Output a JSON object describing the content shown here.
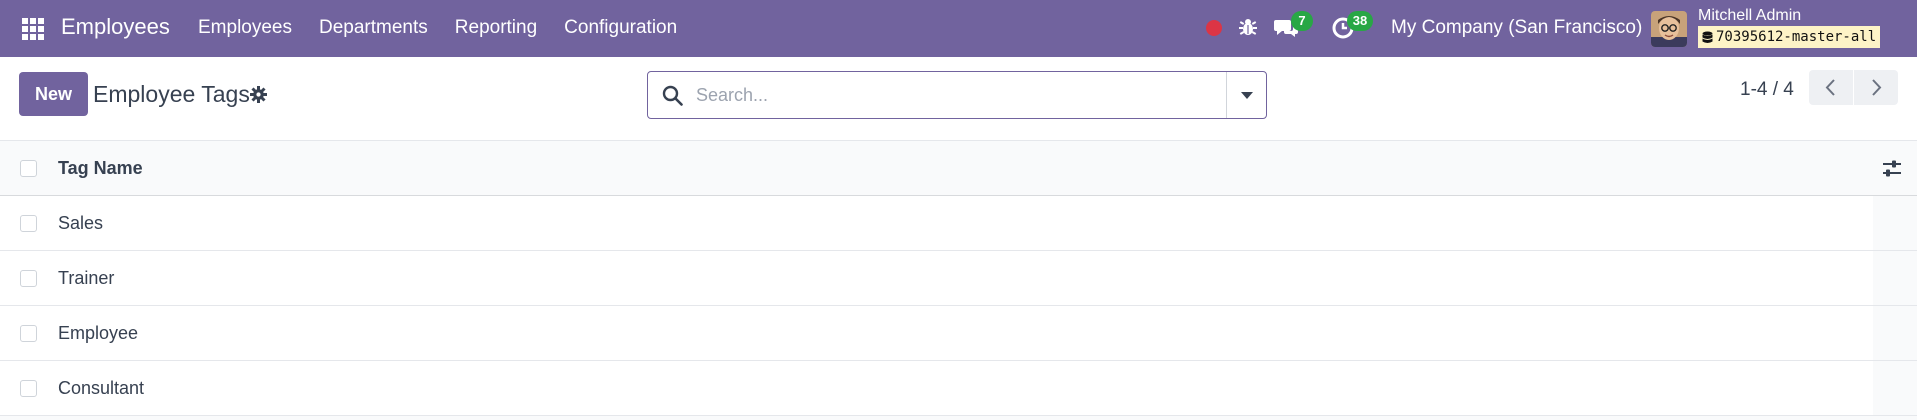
{
  "navbar": {
    "app_title": "Employees",
    "menu": [
      {
        "label": "Employees"
      },
      {
        "label": "Departments"
      },
      {
        "label": "Reporting"
      },
      {
        "label": "Configuration"
      }
    ],
    "chat_count": "7",
    "activity_count": "38",
    "company": "My Company (San Francisco)",
    "user_name": "Mitchell Admin",
    "database": "70395612-master-all",
    "brand_color": "#71639e",
    "badge_color": "#28a745",
    "record_color": "#dc3545"
  },
  "control_panel": {
    "new_label": "New",
    "title": "Employee Tags",
    "search_placeholder": "Search...",
    "pager": "1-4 / 4"
  },
  "list": {
    "column_header": "Tag Name",
    "rows": [
      {
        "name": "Sales"
      },
      {
        "name": "Trainer"
      },
      {
        "name": "Employee"
      },
      {
        "name": "Consultant"
      }
    ]
  },
  "icons": [
    "apps-grid-icon",
    "bug-icon",
    "chat-icon",
    "clock-icon",
    "gear-icon",
    "search-icon",
    "chevron-left-icon",
    "chevron-right-icon",
    "database-icon",
    "sliders-icon"
  ]
}
